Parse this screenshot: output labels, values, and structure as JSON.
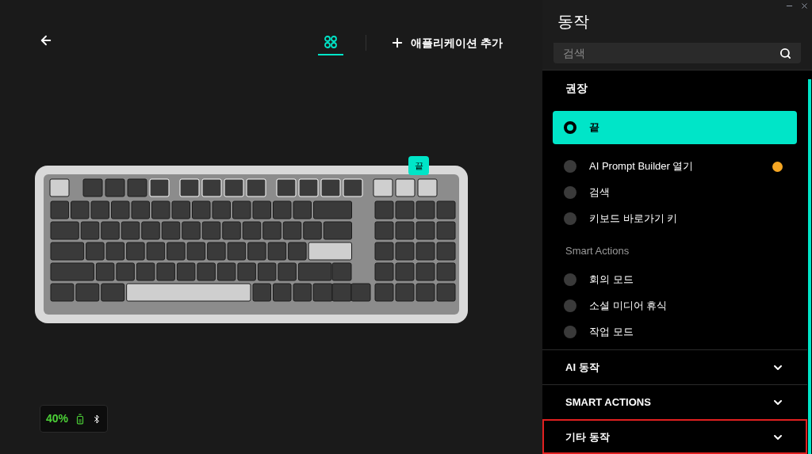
{
  "top_bar": {
    "view_tab": {
      "selected": true
    },
    "add_app_label": "애플리케이션 추가"
  },
  "keyboard": {
    "assigned_key_label": "끝"
  },
  "battery": {
    "percent": "40%"
  },
  "panel": {
    "title": "동작",
    "search": {
      "placeholder": "검색"
    },
    "groups": [
      {
        "heading": "권장",
        "kind": "primary",
        "items": [
          {
            "label": "끝",
            "selected": true,
            "warning": false
          },
          {
            "label": "AI Prompt Builder 열기",
            "selected": false,
            "warning": true
          },
          {
            "label": "검색",
            "selected": false,
            "warning": false
          },
          {
            "label": "키보드 바로가기 키",
            "selected": false,
            "warning": false
          }
        ]
      },
      {
        "heading": "Smart Actions",
        "kind": "secondary",
        "items": [
          {
            "label": "회의 모드",
            "selected": false,
            "warning": false
          },
          {
            "label": "소셜 미디어 휴식",
            "selected": false,
            "warning": false
          },
          {
            "label": "작업 모드",
            "selected": false,
            "warning": false
          }
        ]
      }
    ],
    "sections": [
      {
        "label": "AI 동작",
        "expanded": false,
        "highlighted": false
      },
      {
        "label": "SMART ACTIONS",
        "expanded": false,
        "highlighted": false
      },
      {
        "label": "기타 동작",
        "expanded": false,
        "highlighted": true
      }
    ]
  }
}
